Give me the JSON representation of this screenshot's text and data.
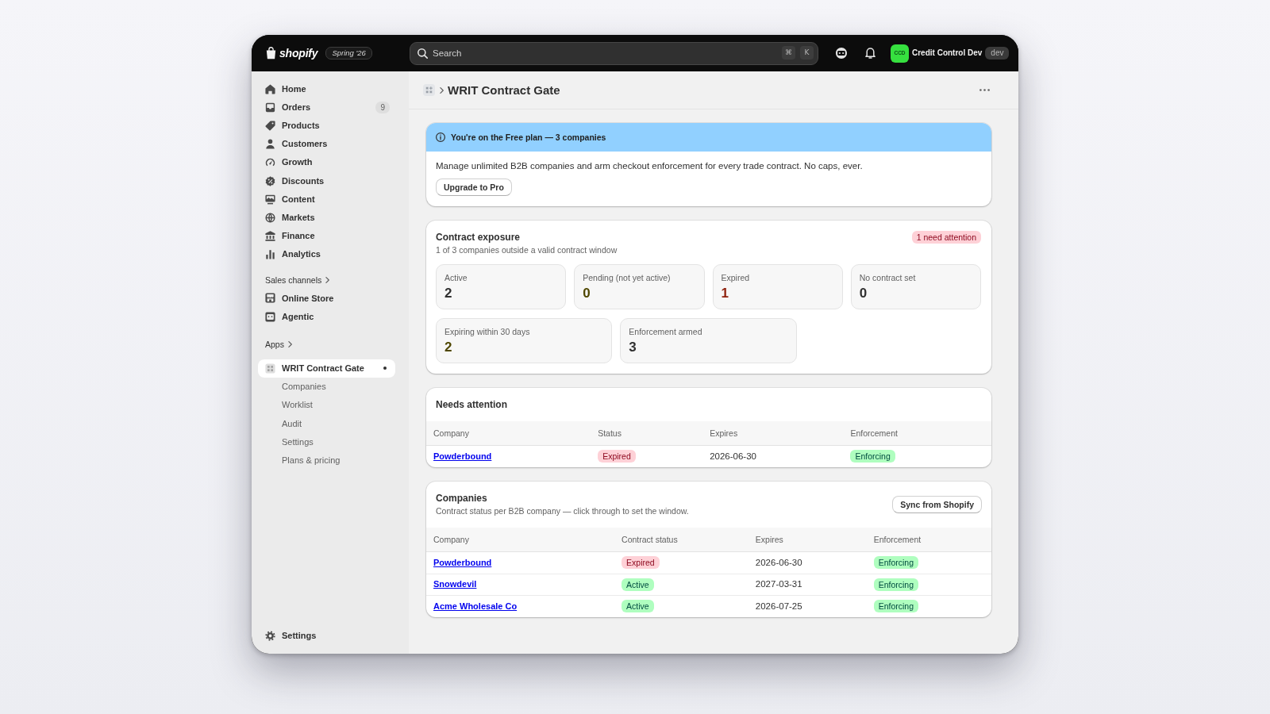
{
  "top_bar": {
    "brand": "shopify",
    "edition": "Spring '26",
    "search": {
      "placeholder": "Search",
      "shortcut_keys": [
        "⌘",
        "K"
      ]
    },
    "store": {
      "initials": "CCD",
      "name": "Credit Control Dev",
      "tag": "dev"
    }
  },
  "sidebar": {
    "items": [
      {
        "label": "Home",
        "selected": false
      },
      {
        "label": "Orders",
        "count": "9",
        "selected": false
      },
      {
        "label": "Products",
        "selected": false
      },
      {
        "label": "Customers",
        "selected": false
      },
      {
        "label": "Growth",
        "selected": false
      },
      {
        "label": "Discounts",
        "selected": false
      },
      {
        "label": "Content",
        "selected": false
      },
      {
        "label": "Markets",
        "selected": false
      },
      {
        "label": "Finance",
        "selected": false
      },
      {
        "label": "Analytics",
        "selected": false
      }
    ],
    "sections": [
      {
        "title": "Sales channels",
        "items": [
          {
            "label": "Online Store",
            "selected": false
          },
          {
            "label": "Agentic",
            "selected": false
          }
        ]
      },
      {
        "title": "Apps",
        "items": [
          {
            "label": "WRIT Contract Gate",
            "selected": true,
            "children": [
              {
                "label": "Companies",
                "selected": false
              },
              {
                "label": "Worklist",
                "selected": false
              },
              {
                "label": "Audit",
                "selected": false
              },
              {
                "label": "Settings",
                "selected": false
              },
              {
                "label": "Plans & pricing",
                "selected": false
              }
            ]
          }
        ]
      }
    ],
    "footer_item": {
      "label": "Settings",
      "selected": false
    }
  },
  "page": {
    "title": "WRIT Contract Gate"
  },
  "plan_banner": {
    "title": "You're on the Free plan — 3 companies",
    "text": "Manage unlimited B2B companies and arm checkout enforcement for every trade contract. No caps, ever.",
    "button": "Upgrade to Pro"
  },
  "exposure": {
    "title": "Contract exposure",
    "subtitle": "1 of 3 companies outside a valid contract window",
    "badge": {
      "text": "1 need attention",
      "kind": "critical"
    },
    "stat_rows": [
      {
        "items": [
          {
            "label": "Active",
            "value": "2",
            "color": "#303030"
          },
          {
            "label": "Pending (not yet active)",
            "value": "0",
            "color": "#4f4700"
          },
          {
            "label": "Expired",
            "value": "1",
            "color": "#8e1f0b"
          },
          {
            "label": "No contract set",
            "value": "0",
            "color": "#303030"
          }
        ]
      },
      {
        "items": [
          {
            "label": "Expiring within 30 days",
            "value": "2",
            "color": "#4f4700"
          },
          {
            "label": "Enforcement armed",
            "value": "3",
            "color": "#303030"
          }
        ]
      }
    ]
  },
  "needs_attention": {
    "title": "Needs attention",
    "columns": [
      "Company",
      "Status",
      "Expires",
      "Enforcement"
    ],
    "rows": [
      {
        "company": "Powderbound",
        "status": {
          "text": "Expired",
          "kind": "critical"
        },
        "expires": "2026-06-30",
        "enforcement": {
          "text": "Enforcing",
          "kind": "success"
        }
      }
    ]
  },
  "companies": {
    "title": "Companies",
    "subtitle": "Contract status per B2B company — click through to set the window.",
    "button": "Sync from Shopify",
    "columns": [
      "Company",
      "Contract status",
      "Expires",
      "Enforcement"
    ],
    "rows": [
      {
        "company": "Powderbound",
        "status": {
          "text": "Expired",
          "kind": "critical"
        },
        "expires": "2026-06-30",
        "enforcement": {
          "text": "Enforcing",
          "kind": "success"
        }
      },
      {
        "company": "Snowdevil",
        "status": {
          "text": "Active",
          "kind": "success"
        },
        "expires": "2027-03-31",
        "enforcement": {
          "text": "Enforcing",
          "kind": "success"
        }
      },
      {
        "company": "Acme Wholesale Co",
        "status": {
          "text": "Active",
          "kind": "success"
        },
        "expires": "2026-07-25",
        "enforcement": {
          "text": "Enforcing",
          "kind": "success"
        }
      }
    ]
  }
}
